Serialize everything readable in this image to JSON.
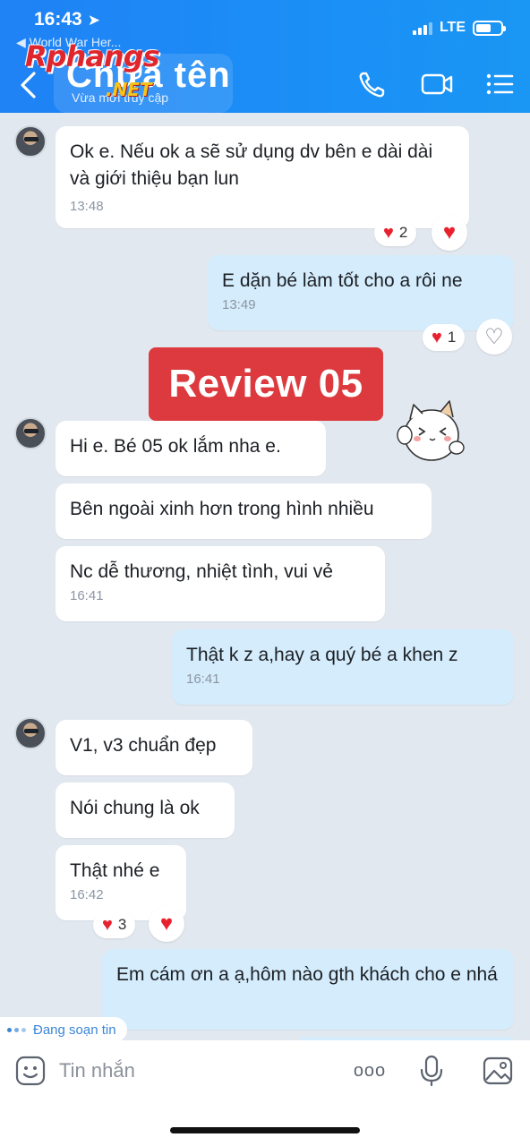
{
  "status_bar": {
    "time": "16:43",
    "network": "LTE",
    "back_app": "◀ World War Her..."
  },
  "header": {
    "contact_name": "Chưa tên",
    "last_seen": "Vừa mới truy cập",
    "watermark": "Rphangs",
    "watermark_sub": ".NET",
    "icons": [
      "back-arrow-icon",
      "phone-icon",
      "video-call-icon",
      "menu-list-icon"
    ]
  },
  "messages": [
    {
      "dir": "in",
      "text": "Ok e. Nếu ok a sẽ sử dụng dv bên e dài dài và giới thiệu bạn lun",
      "time": "13:48",
      "reaction_count": "2"
    },
    {
      "dir": "out",
      "text": "E dặn bé làm tốt cho a rôi ne",
      "time": "13:49",
      "reaction_count": "1"
    },
    {
      "dir": "in",
      "text": "Hi e. Bé 05 ok lắm nha e."
    },
    {
      "dir": "in",
      "text": "Bên ngoài xinh hơn trong hình nhiều"
    },
    {
      "dir": "in",
      "text": "Nc dễ thương, nhiệt tình, vui vẻ",
      "time": "16:41"
    },
    {
      "dir": "out",
      "text": "Thật k z a,hay a quý bé a khen z",
      "time": "16:41"
    },
    {
      "dir": "in",
      "text": "V1, v3 chuẩn đẹp"
    },
    {
      "dir": "in",
      "text": "Nói chung là ok"
    },
    {
      "dir": "in",
      "text": "Thật nhé e",
      "time": "16:42",
      "reaction_count": "3"
    },
    {
      "dir": "out",
      "text": "Em cám ơn a ạ,hôm nào gth khách cho e nhá"
    }
  ],
  "banner": "Review 05",
  "typing": "Đang soạn tin",
  "composer": {
    "placeholder": "Tin nhắn",
    "more": "ooo"
  },
  "colors": {
    "header": "#1b8ff6",
    "outgoing": "#d4ecfc",
    "incoming": "#ffffff",
    "banner": "#dc3a3f",
    "heart": "#e8212e"
  }
}
